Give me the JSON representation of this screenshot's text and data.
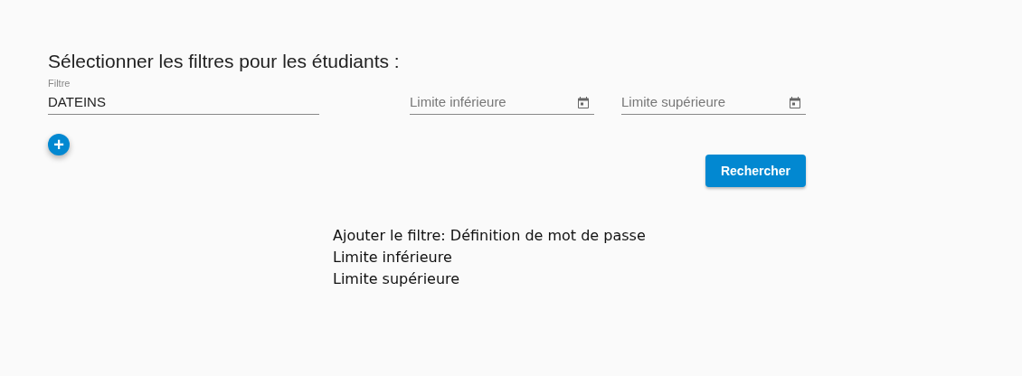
{
  "heading": "Sélectionner les filtres pour les étudiants :",
  "filter": {
    "label": "Filtre",
    "value": "DATEINS"
  },
  "date_fields": [
    {
      "placeholder": "Limite inférieure"
    },
    {
      "placeholder": "Limite supérieure"
    }
  ],
  "add_button": {
    "symbol": "+"
  },
  "search_button": {
    "label": "Rechercher"
  },
  "notes": [
    "Ajouter le filtre: Définition de mot de passe",
    "Limite inférieure",
    "Limite supérieure"
  ]
}
